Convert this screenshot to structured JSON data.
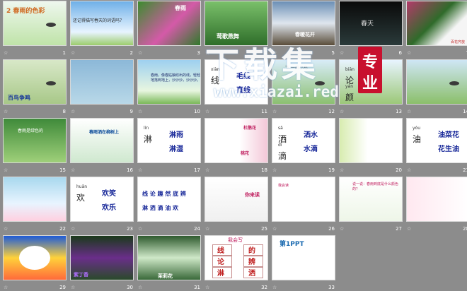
{
  "slides": [
    {
      "num": "1",
      "title": "2 春雨的色彩"
    },
    {
      "num": "2",
      "title": "还记得描写春天的词语吗？"
    },
    {
      "num": "3",
      "title": "春雨"
    },
    {
      "num": "4",
      "title": "莺歌燕舞"
    },
    {
      "num": "5",
      "title": "春暖花开"
    },
    {
      "num": "6",
      "title": "春天"
    },
    {
      "num": "7",
      "title": "百花齐放"
    },
    {
      "num": "8",
      "title": "百鸟争鸣"
    },
    {
      "num": "9",
      "title": ""
    },
    {
      "num": "10",
      "title": "春雨，像春姑娘纺出的线，轻轻地落到地上，沙沙沙，沙沙沙。"
    },
    {
      "num": "11",
      "p1": "xiàn",
      "c1": "线",
      "w1": "毛线",
      "w2": "直线"
    },
    {
      "num": "12",
      "title": "下 一群小鸟…"
    },
    {
      "num": "13",
      "p1": "biān",
      "c1": "论",
      "p2": "yán",
      "c2": "颜"
    },
    {
      "num": "14",
      "title": ""
    },
    {
      "num": "15",
      "title": "春雨是绿色的"
    },
    {
      "num": "16",
      "title": "春雨洒在柳树上"
    },
    {
      "num": "17",
      "p1": "lín",
      "c1": "淋",
      "w1": "淋雨",
      "w2": "淋湿"
    },
    {
      "num": "18",
      "title": "杜鹃花",
      "sub": "桃花"
    },
    {
      "num": "19",
      "p1": "sǎ",
      "c1": "洒",
      "w1": "洒水",
      "p2": "dī",
      "c2": "滴",
      "w2": "水滴"
    },
    {
      "num": "20",
      "title": ""
    },
    {
      "num": "21",
      "p1": "yóu",
      "c1": "油",
      "w1": "油菜花",
      "w2": "花生油"
    },
    {
      "num": "22",
      "title": ""
    },
    {
      "num": "23",
      "p1": "huān",
      "c1": "欢",
      "w1": "欢笑",
      "w2": "欢乐"
    },
    {
      "num": "24",
      "row1": "线 论 趣 然 底 辨",
      "row2": "淋 洒 滴 油 欢"
    },
    {
      "num": "25",
      "title": "你来读"
    },
    {
      "num": "26",
      "title": "我会读"
    },
    {
      "num": "27",
      "title": "说一说：春雨到底是什么颜色的？"
    },
    {
      "num": "28",
      "title": ""
    },
    {
      "num": "29",
      "title": ""
    },
    {
      "num": "30",
      "title": "紫丁香"
    },
    {
      "num": "31",
      "title": "茉莉花"
    },
    {
      "num": "32",
      "title": "我会写",
      "c1": "线",
      "c2": "的",
      "c3": "论",
      "c4": "辨",
      "c5": "淋",
      "c6": "洒"
    },
    {
      "num": "33",
      "title": "第1PPT"
    }
  ],
  "watermark": {
    "cn": "下载集",
    "url": "www.xiazai.red",
    "badge_top": "专",
    "badge_bottom": "业"
  }
}
